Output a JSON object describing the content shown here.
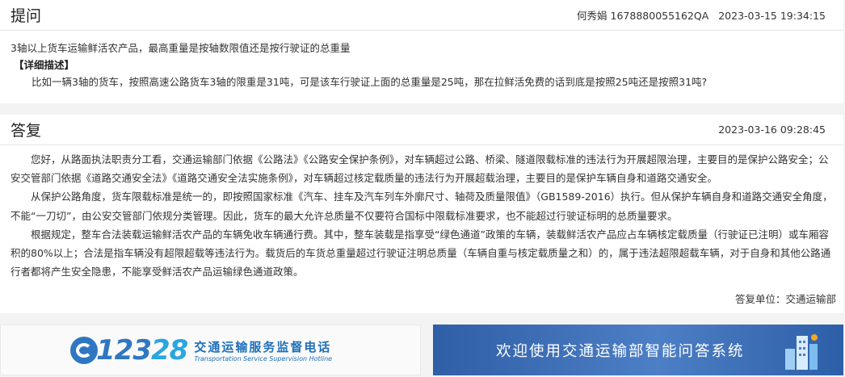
{
  "question": {
    "title": "提问",
    "asker": "何秀娟 1678880055162QA",
    "time": "2023-03-15 19:34:15",
    "subject": "3轴以上货车运输鲜活农产品，最高重量是按轴数限值还是按行驶证的总重量",
    "detail_label": "【详细描述】",
    "detail_text": "比如一辆3轴的货车，按照高速公路货车3轴的限重是31吨，可是该车行驶证上面的总重量是25吨，那在拉鲜活免费的话到底是按照25吨还是按照31吨?"
  },
  "answer": {
    "title": "答复",
    "time": "2023-03-16 09:28:45",
    "paragraphs": [
      "您好，从路面执法职责分工看，交通运输部门依据《公路法》《公路安全保护条例》，对车辆超过公路、桥梁、隧道限载标准的违法行为开展超限治理，主要目的是保护公路安全；公安交管部门依据《道路交通安全法》《道路交通安全法实施条例》，对车辆超过核定载质量的违法行为开展超载治理，主要目的是保护车辆自身和道路交通安全。",
      "从保护公路角度，货车限载标准是统一的，即按照国家标准《汽车、挂车及汽车列车外廓尺寸、轴荷及质量限值》（GB1589-2016）执行。但从保护车辆自身和道路交通安全角度，不能“一刀切”，由公安交管部门依规分类管理。因此，货车的最大允许总质量不仅要符合国标中限载标准要求，也不能超过行驶证标明的总质量要求。",
      "根据规定，整车合法装载运输鲜活农产品的车辆免收车辆通行费。其中，整车装载是指享受“绿色通道”政策的车辆，装载鲜活农产品应占车辆核定载质量（行驶证已注明）或车厢容积的80%以上；合法是指车辆没有超限超载等违法行为。载货后的车货总重量超过行驶证注明总质量（车辆自重与核定载质量之和）的，属于违法超限超载车辆，对于自身和其他公路通行者都将产生安全隐患，不能享受鲜活农产品运输绿色通道政策。"
    ],
    "unit": "答复单位：交通运输部"
  },
  "banners": {
    "hotline_number_main": "123",
    "hotline_number_accent": "28",
    "hotline_cn": "交通运输服务监督电话",
    "hotline_en": "Transportation Service Supervision Hotline",
    "welcome": "欢迎使用交通运输部智能问答系统"
  }
}
